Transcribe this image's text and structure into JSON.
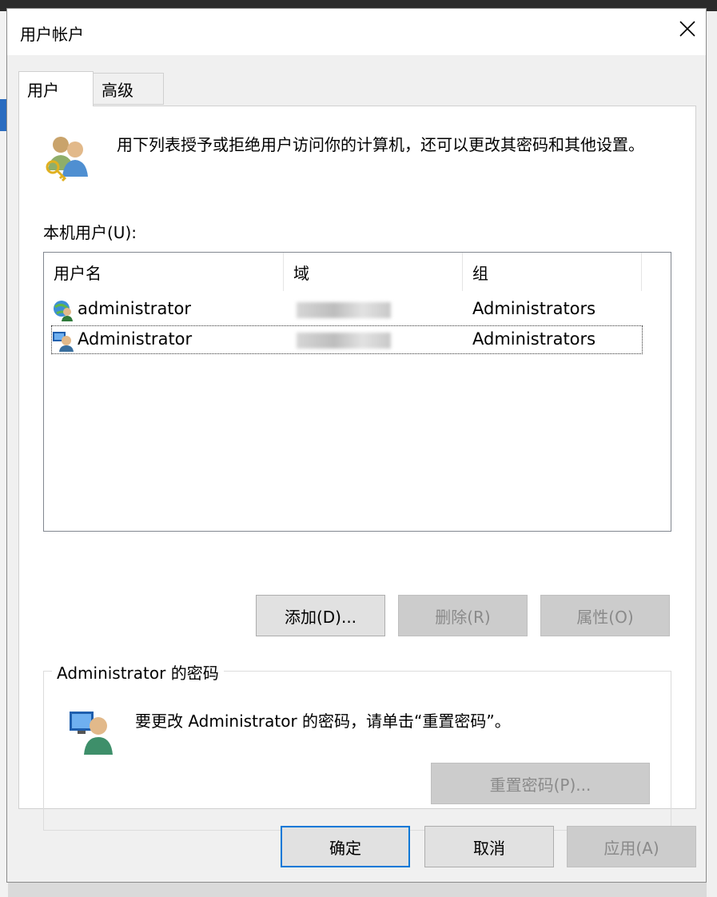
{
  "window": {
    "title": "用户帐户"
  },
  "tabs": [
    {
      "label": "用户",
      "selected": true
    },
    {
      "label": "高级",
      "selected": false
    }
  ],
  "intro_text": "用下列表授予或拒绝用户访问你的计算机，还可以更改其密码和其他设置。",
  "list_label": "本机用户(U):",
  "columns": {
    "name": "用户名",
    "domain": "域",
    "group": "组"
  },
  "users": [
    {
      "name": "administrator",
      "domain": "",
      "group": "Administrators",
      "icon": "domain-user-icon"
    },
    {
      "name": "Administrator",
      "domain": "",
      "group": "Administrators",
      "icon": "local-user-icon"
    }
  ],
  "buttons": {
    "add": "添加(D)...",
    "remove": "删除(R)",
    "properties": "属性(O)",
    "reset_password": "重置密码(P)...",
    "ok": "确定",
    "cancel": "取消",
    "apply": "应用(A)"
  },
  "password_group": {
    "title": "Administrator 的密码",
    "text": "要更改 Administrator 的密码，请单击“重置密码”。"
  },
  "colors": {
    "accent": "#0078d7",
    "disabled_bg": "#cccccc",
    "disabled_text": "#8a8a8a"
  }
}
